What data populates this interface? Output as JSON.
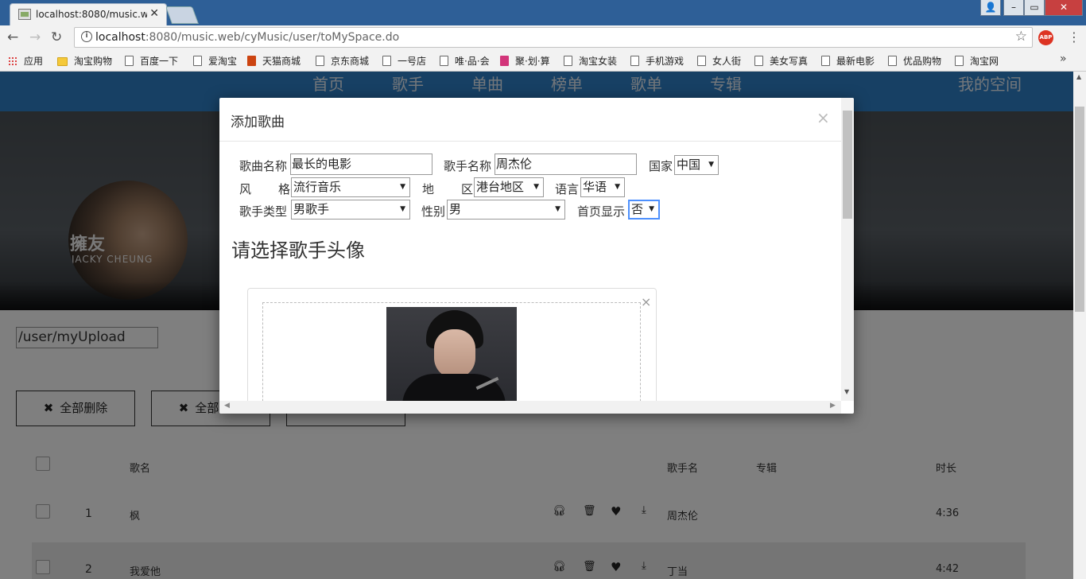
{
  "browser": {
    "tab_title": "localhost:8080/music.w",
    "url_host": "localhost",
    "url_rest": ":8080/music.web/cyMusic/user/toMySpace.do",
    "abp_label": "ABP",
    "bookmarks": [
      "应用",
      "淘宝购物",
      "百度一下",
      "爱淘宝",
      "天猫商城",
      "京东商城",
      "一号店",
      "唯·品·会",
      "聚·划·算",
      "淘宝女装",
      "手机游戏",
      "女人街",
      "美女写真",
      "最新电影",
      "优品购物",
      "淘宝网"
    ]
  },
  "site_nav": {
    "items": [
      "首页",
      "歌手",
      "单曲",
      "榜单",
      "歌单",
      "专辑"
    ],
    "my_space": "我的空间"
  },
  "banner": {
    "avatar_text": "擁友",
    "avatar_subtext": "JACKY CHEUNG"
  },
  "upload_path": "/user/myUpload",
  "actions": [
    "全部删除",
    "全部删除",
    ""
  ],
  "table": {
    "headers": {
      "song": "歌名",
      "singer": "歌手名",
      "album": "专辑",
      "duration": "时长"
    },
    "rows": [
      {
        "index": "1",
        "song": "枫",
        "singer": "周杰伦",
        "album": "",
        "duration": "4:36"
      },
      {
        "index": "2",
        "song": "我爱他",
        "singer": "丁当",
        "album": "",
        "duration": "4:42"
      }
    ]
  },
  "modal": {
    "title": "添加歌曲",
    "close": "×",
    "labels": {
      "song_name": "歌曲名称",
      "singer_name": "歌手名称",
      "country": "国家",
      "style_a": "风",
      "style_b": "格",
      "region_a": "地",
      "region_b": "区",
      "language": "语言",
      "singer_type": "歌手类型",
      "gender": "性别",
      "homepage": "首页显示"
    },
    "values": {
      "song_name": "最长的电影",
      "singer_name": "周杰伦",
      "country": "中国",
      "style": "流行音乐",
      "region": "港台地区",
      "language": "华语",
      "singer_type": "男歌手",
      "gender": "男",
      "homepage": "否"
    },
    "subtitle": "请选择歌手头像",
    "upload_close": "×"
  }
}
